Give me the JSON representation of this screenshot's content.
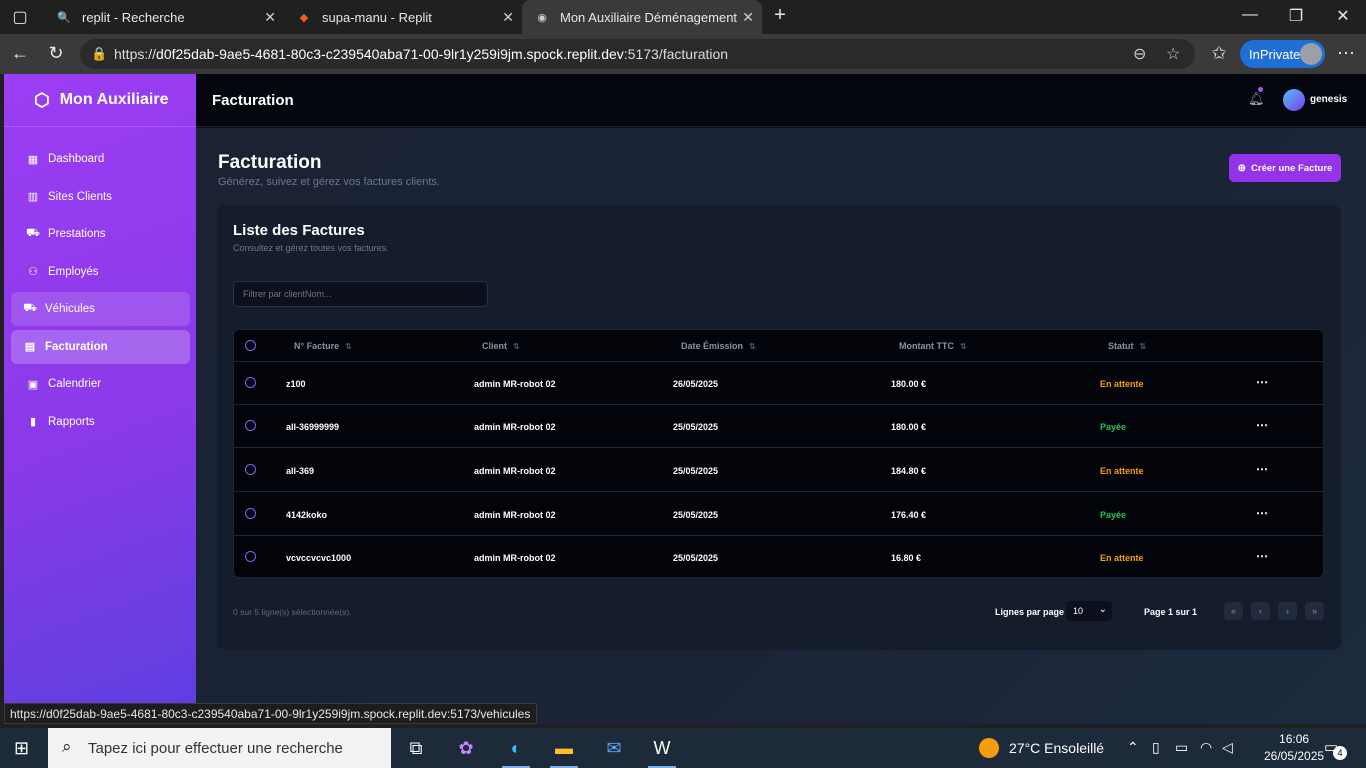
{
  "browser": {
    "tabs": [
      {
        "title": "replit - Recherche",
        "icon": "search-icon"
      },
      {
        "title": "supa-manu - Replit",
        "icon": "replit-icon"
      },
      {
        "title": "Mon Auxiliaire Déménagement",
        "icon": "app-icon"
      }
    ],
    "url_prefix": "https://",
    "url_host": "d0f25dab-9ae5-4681-80c3-c239540aba71-00-9lr1y259i9jm.spock.replit.dev",
    "url_path": ":5173/facturation",
    "inprivate_label": "InPrivate",
    "status_link": "https://d0f25dab-9ae5-4681-80c3-c239540aba71-00-9lr1y259i9jm.spock.replit.dev:5173/vehicules"
  },
  "sidebar": {
    "brand": "Mon Auxiliaire",
    "items": [
      {
        "label": "Dashboard",
        "icon": "grid-icon"
      },
      {
        "label": "Sites Clients",
        "icon": "building-icon"
      },
      {
        "label": "Prestations",
        "icon": "truck-icon"
      },
      {
        "label": "Employés",
        "icon": "users-icon"
      },
      {
        "label": "Véhicules",
        "icon": "truck-icon"
      },
      {
        "label": "Facturation",
        "icon": "file-icon"
      },
      {
        "label": "Calendrier",
        "icon": "calendar-icon"
      },
      {
        "label": "Rapports",
        "icon": "bar-chart-icon"
      }
    ]
  },
  "topbar": {
    "title": "Facturation",
    "user_name": "genesis"
  },
  "page": {
    "title": "Facturation",
    "subtitle": "Générez, suivez et gérez vos factures clients.",
    "create_button": "Créer une Facture"
  },
  "card": {
    "title": "Liste des Factures",
    "subtitle": "Consultez et gérez toutes vos factures.",
    "filter_placeholder": "Filtrer par clientNom..."
  },
  "table": {
    "headers": [
      "N° Facture",
      "Client",
      "Date Émission",
      "Montant TTC",
      "Statut"
    ],
    "rows": [
      {
        "numero": "z100",
        "client": "admin MR-robot 02",
        "date": "26/05/2025",
        "montant": "180.00 €",
        "statut": "En attente"
      },
      {
        "numero": "all-36999999",
        "client": "admin MR-robot 02",
        "date": "25/05/2025",
        "montant": "180.00 €",
        "statut": "Payée"
      },
      {
        "numero": "all-369",
        "client": "admin MR-robot 02",
        "date": "25/05/2025",
        "montant": "184.80 €",
        "statut": "En attente"
      },
      {
        "numero": "4142koko",
        "client": "admin MR-robot 02",
        "date": "25/05/2025",
        "montant": "176.40 €",
        "statut": "Payée"
      },
      {
        "numero": "vcvccvcvc1000",
        "client": "admin MR-robot 02",
        "date": "25/05/2025",
        "montant": "16.80 €",
        "statut": "En attente"
      }
    ]
  },
  "pagination": {
    "selection_info": "0 sur 5 ligne(s) sélectionnée(s).",
    "rows_per_page_label": "Lignes par page",
    "rows_per_page_value": "10",
    "page_info": "Page 1 sur 1"
  },
  "taskbar": {
    "search_placeholder": "Tapez ici pour effectuer une recherche",
    "weather": "27°C  Ensoleillé",
    "time": "16:06",
    "date": "26/05/2025",
    "notifications": "4"
  },
  "colors": {
    "accent": "#9333ea",
    "pending": "#f59e0b",
    "paid": "#22c55e"
  }
}
